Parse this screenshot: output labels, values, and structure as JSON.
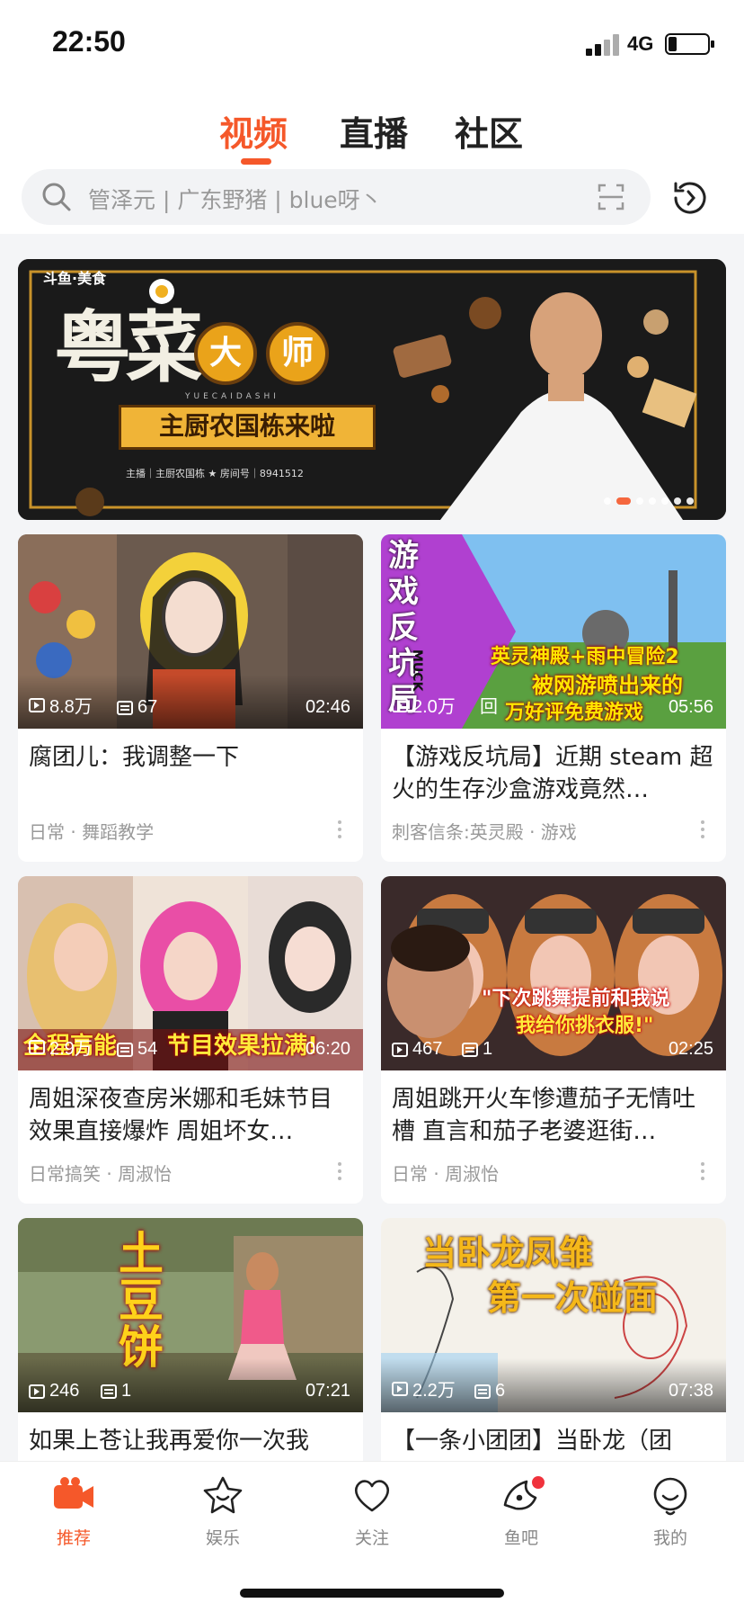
{
  "status": {
    "time": "22:50",
    "network": "4G",
    "battery_level": 0.22
  },
  "tabs": [
    {
      "label": "视频",
      "active": true
    },
    {
      "label": "直播",
      "active": false
    },
    {
      "label": "社区",
      "active": false
    }
  ],
  "search": {
    "placeholder": "管泽元 | 广东野猪 | blue呀丶",
    "icon": "search-icon",
    "right_icon": "scan-icon"
  },
  "history_icon": "history-icon",
  "banner": {
    "logo": "斗鱼·美食",
    "title": "粤菜",
    "circle_1": "大",
    "circle_2": "师",
    "pinyin": "YUECAIDASHI",
    "ribbon": "主厨农国栋来啦",
    "info": "主播｜主厨农国栋   ★   房间号｜8941512",
    "slide_count": 7,
    "active_slide": 2
  },
  "videos": [
    {
      "views": "8.8万",
      "comments": "67",
      "duration": "02:46",
      "title": "腐团儿：我调整一下",
      "meta": "日常 · 舞蹈教学",
      "overlay": []
    },
    {
      "views": "2.0万",
      "comments": "回",
      "duration": "05:56",
      "title": "【游戏反坑局】近期 steam 超火的生存沙盒游戏竟然…",
      "meta": "刺客信条:英灵殿 · 游戏",
      "overlay": [
        "游",
        "戏",
        "反",
        "坑",
        "局",
        "MUCK",
        "英灵神殿+雨中冒险2",
        "被网游喷出来的",
        "万好评免费游戏"
      ]
    },
    {
      "views": "2.9万",
      "comments": "54",
      "duration": "06:20",
      "title": "周姐深夜查房米娜和毛妹节目效果直接爆炸 周姐坏女…",
      "meta": "日常搞笑 · 周淑怡",
      "overlay": [
        "全程高能",
        "节目效果拉满!"
      ]
    },
    {
      "views": "467",
      "comments": "1",
      "duration": "02:25",
      "title": "周姐跳开火车惨遭茄子无情吐槽 直言和茄子老婆逛街…",
      "meta": "日常 · 周淑怡",
      "overlay": [
        "\"下次跳舞提前和我说",
        "我给你挑衣服!\""
      ]
    },
    {
      "views": "246",
      "comments": "1",
      "duration": "07:21",
      "title": "如果上苍让我再爱你一次我",
      "meta": "",
      "overlay": [
        "土",
        "豆",
        "饼"
      ]
    },
    {
      "views": "2.2万",
      "comments": "6",
      "duration": "07:38",
      "title": "【一条小团团】当卧龙（团",
      "meta": "",
      "overlay": [
        "当卧龙凤雏",
        "第一次碰面"
      ]
    }
  ],
  "tabbar": [
    {
      "label": "推荐",
      "icon": "video-camera-icon",
      "active": true
    },
    {
      "label": "娱乐",
      "icon": "star-face-icon",
      "active": false
    },
    {
      "label": "关注",
      "icon": "heart-icon",
      "active": false
    },
    {
      "label": "鱼吧",
      "icon": "fish-bar-icon",
      "active": false,
      "badge": true
    },
    {
      "label": "我的",
      "icon": "profile-icon",
      "active": false
    }
  ],
  "colors": {
    "accent": "#f5582a",
    "badge": "#f0323c"
  }
}
